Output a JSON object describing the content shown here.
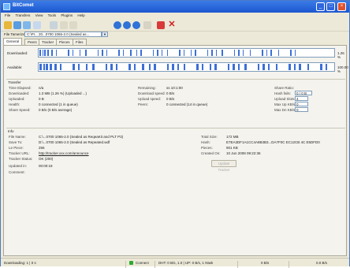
{
  "window": {
    "title": "BitComet",
    "minimize_label": "_",
    "maximize_label": "□",
    "close_label": "×"
  },
  "menu": [
    "File",
    "Transfers",
    "View",
    "Tools",
    "Plugins",
    "Help"
  ],
  "toolbar": {
    "icons": [
      "open-torrent-icon",
      "new-torrent-icon",
      "save-icon",
      "refresh-icon",
      "start-icon",
      "arrow-icon",
      "arrow-icon",
      "gear-icon",
      "search-icon",
      "remove-icon",
      "stop-icon",
      "delete-icon"
    ]
  },
  "address": {
    "label": "File Tamerizer:",
    "value": "C:\\Pr... 20...0700 1065-2.0 (Sealed as...",
    "drop": "▼"
  },
  "tabs": [
    "General",
    "Peers",
    "Tracker",
    "Pieces",
    "Files"
  ],
  "pieces": {
    "downloaded_label": "Downloaded:",
    "available_label": "Available:",
    "downloaded_pct": "1.26 %",
    "available_pct": "100.00 %"
  },
  "transfer": {
    "header": "Transfer",
    "rows_left": [
      {
        "label": "Time Elapsed:",
        "value": "n/a"
      },
      {
        "label": "Downloaded:",
        "value": "1.3 MB (1.26 %) (Uploaded ...)"
      },
      {
        "label": "Uploaded:",
        "value": "0 B"
      },
      {
        "label": "Health:",
        "value": "0 connected (1 in queue)"
      },
      {
        "label": "Share Speed:",
        "value": "0 B/s (0 B/s average)"
      }
    ],
    "rows_mid": [
      {
        "label": "Remaining:",
        "value": "ss 10:1:00"
      },
      {
        "label": "Download speed:",
        "value": "0 B/s"
      },
      {
        "label": "Upload speed:",
        "value": "0 B/s"
      },
      {
        "label": "Peers:",
        "value": "0 connected (14 in queue)"
      }
    ],
    "rows_right": [
      {
        "label": "Share Ratio:",
        "value": ""
      },
      {
        "label": "Hash fails:",
        "value": "0 / 0 B"
      },
      {
        "label": "Upload Slots:",
        "value": "4"
      },
      {
        "label": "Max Up KB/s:",
        "value": "0"
      },
      {
        "label": "Max Dn KB/s:",
        "value": "0"
      }
    ]
  },
  "info": {
    "header": "Info",
    "rows_left": [
      {
        "label": "File Name:",
        "value": "C:\\...0700 1065-2.0 (Sealed as ReqeaKit and PLT P3)"
      },
      {
        "label": "Save To:",
        "value": "D:\\...0700 1065-2.0 (Sealed as Repeated.wdf"
      },
      {
        "label": "Le Piece:",
        "value": "256"
      },
      {
        "label": "Tracker URL:",
        "value": "http://tracker.xxx.com/announce",
        "link": true
      },
      {
        "label": "Tracker Status:",
        "value": "OK (200)"
      },
      {
        "label": "Updated in:",
        "value": "00:00:18"
      },
      {
        "label": "Comment:",
        "value": ""
      }
    ],
    "rows_right": [
      {
        "label": "Total Size:",
        "value": "172 MB"
      },
      {
        "label": "Hash:",
        "value": "E7EA3DF1A1CC4A8B3B3...DA7F0C EC12CB 4C E5DFD0"
      },
      {
        "label": "Pieces:",
        "value": "901 KB"
      },
      {
        "label": "Created On:",
        "value": "10 Jun 2008 09:22:36"
      }
    ],
    "update_button": "Update Tracker"
  },
  "status": {
    "left": "Downloading: 1 | 0 s",
    "net": "Connect",
    "speeds": "DHT: 0 B/s, 1.0 | UP: 0 B/s, 1 Ntwk",
    "peers": "0 B/s",
    "ratio": "0.0 B/s"
  },
  "colors": {
    "accent": "#1c56cf",
    "piece_blue": "#3b6fd8",
    "close_red": "#e0522f",
    "status_green": "#2eaa2e"
  }
}
